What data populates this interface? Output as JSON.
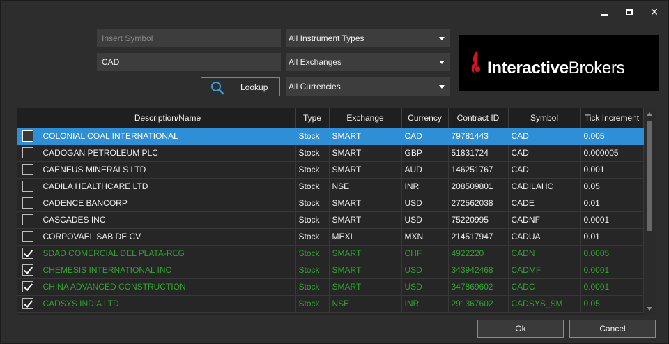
{
  "window": {
    "controls": {
      "minimize": "minimize",
      "maximize": "maximize",
      "close": "✕"
    }
  },
  "search": {
    "symbol_placeholder": "Insert Symbol",
    "symbol_value": "",
    "name_value": "CAD",
    "lookup_label": "Lookup",
    "instrument_type": "All Instrument Types",
    "exchange": "All Exchanges",
    "currency": "All Currencies"
  },
  "logo": {
    "part1": "Interactive",
    "part2": "Brokers",
    "accent": "#d81222"
  },
  "table": {
    "columns": [
      "",
      "Description/Name",
      "Type",
      "Exchange",
      "Currency",
      "Contract ID",
      "Symbol",
      "Tick Increment"
    ],
    "rows": [
      {
        "checked": false,
        "selected": true,
        "done": false,
        "name": "COLONIAL COAL INTERNATIONAL",
        "type": "Stock",
        "exchange": "SMART",
        "currency": "CAD",
        "contract_id": "79781443",
        "symbol": "CAD",
        "tick": "0.005"
      },
      {
        "checked": false,
        "selected": false,
        "done": false,
        "name": "CADOGAN PETROLEUM PLC",
        "type": "Stock",
        "exchange": "SMART",
        "currency": "GBP",
        "contract_id": "51831724",
        "symbol": "CAD",
        "tick": "0.000005"
      },
      {
        "checked": false,
        "selected": false,
        "done": false,
        "name": "CAENEUS MINERALS LTD",
        "type": "Stock",
        "exchange": "SMART",
        "currency": "AUD",
        "contract_id": "146251767",
        "symbol": "CAD",
        "tick": "0.001"
      },
      {
        "checked": false,
        "selected": false,
        "done": false,
        "name": "CADILA HEALTHCARE LTD",
        "type": "Stock",
        "exchange": "NSE",
        "currency": "INR",
        "contract_id": "208509801",
        "symbol": "CADILAHC",
        "tick": "0.05"
      },
      {
        "checked": false,
        "selected": false,
        "done": false,
        "name": "CADENCE BANCORP",
        "type": "Stock",
        "exchange": "SMART",
        "currency": "USD",
        "contract_id": "272562038",
        "symbol": "CADE",
        "tick": "0.01"
      },
      {
        "checked": false,
        "selected": false,
        "done": false,
        "name": "CASCADES INC",
        "type": "Stock",
        "exchange": "SMART",
        "currency": "USD",
        "contract_id": "75220995",
        "symbol": "CADNF",
        "tick": "0.0001"
      },
      {
        "checked": false,
        "selected": false,
        "done": false,
        "name": "CORPOVAEL SAB DE CV",
        "type": "Stock",
        "exchange": "MEXI",
        "currency": "MXN",
        "contract_id": "214517947",
        "symbol": "CADUA",
        "tick": "0.01"
      },
      {
        "checked": true,
        "selected": false,
        "done": true,
        "name": "SDAD COMERCIAL DEL PLATA-REG",
        "type": "Stock",
        "exchange": "SMART",
        "currency": "CHF",
        "contract_id": "4922220",
        "symbol": "CADN",
        "tick": "0.0005"
      },
      {
        "checked": true,
        "selected": false,
        "done": true,
        "name": "CHEMESIS INTERNATIONAL INC",
        "type": "Stock",
        "exchange": "SMART",
        "currency": "USD",
        "contract_id": "343942468",
        "symbol": "CADMF",
        "tick": "0.0001"
      },
      {
        "checked": true,
        "selected": false,
        "done": true,
        "name": "CHINA ADVANCED CONSTRUCTION",
        "type": "Stock",
        "exchange": "SMART",
        "currency": "USD",
        "contract_id": "347869602",
        "symbol": "CADC",
        "tick": "0.0001"
      },
      {
        "checked": true,
        "selected": false,
        "done": true,
        "name": "CADSYS INDIA LTD",
        "type": "Stock",
        "exchange": "NSE",
        "currency": "INR",
        "contract_id": "291367602",
        "symbol": "CADSYS_SM",
        "tick": "0.05"
      }
    ]
  },
  "footer": {
    "ok_label": "Ok",
    "cancel_label": "Cancel"
  },
  "colors": {
    "selection": "#2e8ed6",
    "done_text": "#2fa52f",
    "lookup_border": "#3a9ad9"
  }
}
